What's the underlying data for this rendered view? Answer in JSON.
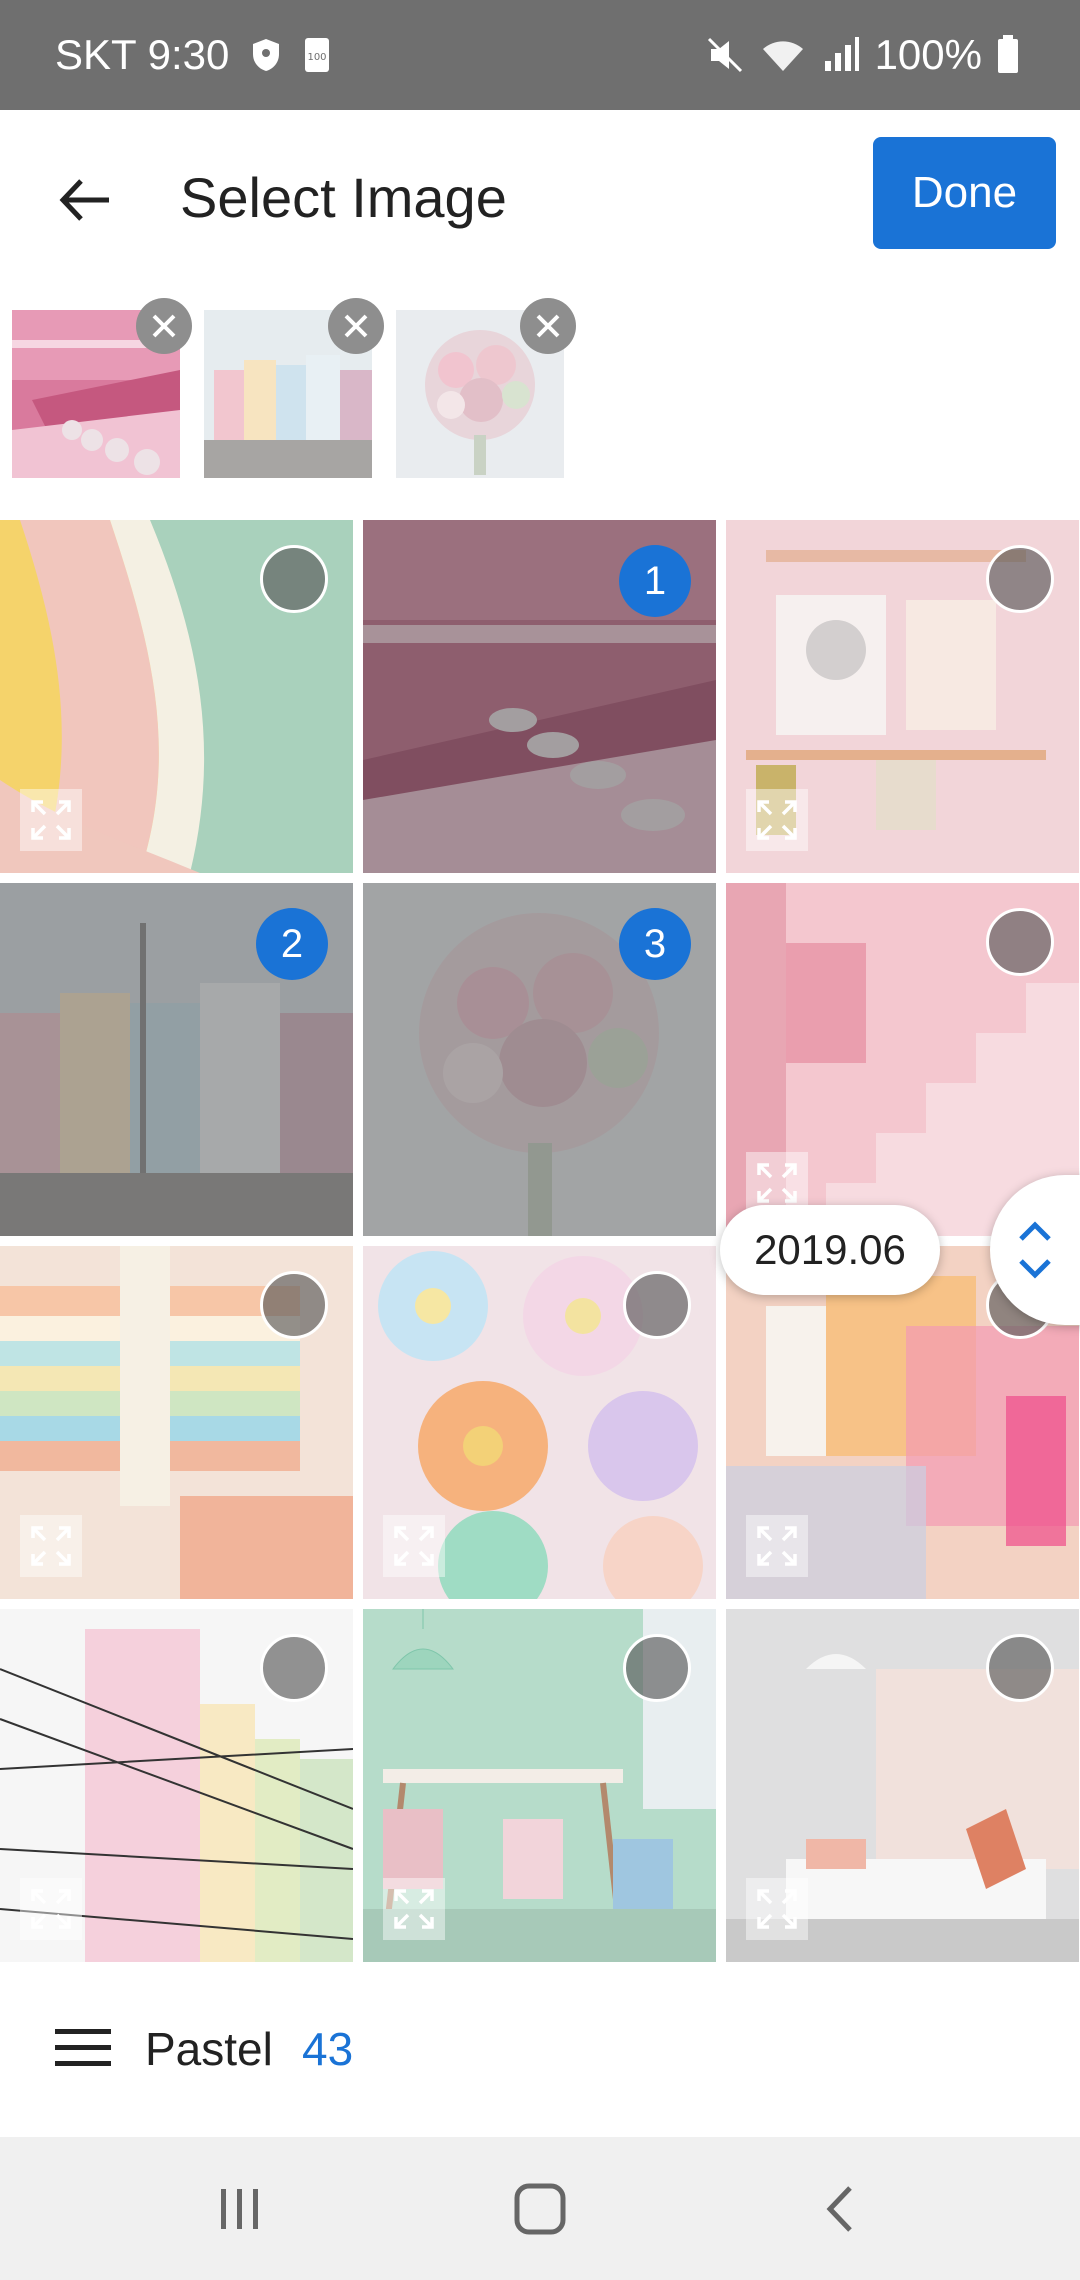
{
  "status_bar": {
    "carrier_time": "SKT 9:30",
    "battery": "100%",
    "storage_label": "100",
    "icons": [
      "shield-icon",
      "storage-icon",
      "mute-icon",
      "wifi-icon",
      "signal-icon",
      "battery-icon"
    ]
  },
  "header": {
    "title": "Select Image",
    "done_label": "Done",
    "back_icon": "arrow-left-icon"
  },
  "selected": [
    {
      "name": "pink-diner",
      "remove_icon": "close-icon"
    },
    {
      "name": "pastel-houses",
      "remove_icon": "close-icon"
    },
    {
      "name": "flower-bouquet",
      "remove_icon": "close-icon"
    }
  ],
  "grid": {
    "selection_numbers": {
      "pink_diner": "1",
      "houses": "2",
      "bouquet": "3"
    },
    "date_label": "2019.06",
    "scroll_icon": "chevron-up-down-icon"
  },
  "album": {
    "name": "Pastel",
    "count": "43",
    "menu_icon": "hamburger-icon"
  },
  "nav": {
    "icons": [
      "recents-icon",
      "home-icon",
      "back-icon"
    ]
  },
  "colors": {
    "accent": "#1a73d6",
    "status_bar": "#6f6f6f"
  }
}
